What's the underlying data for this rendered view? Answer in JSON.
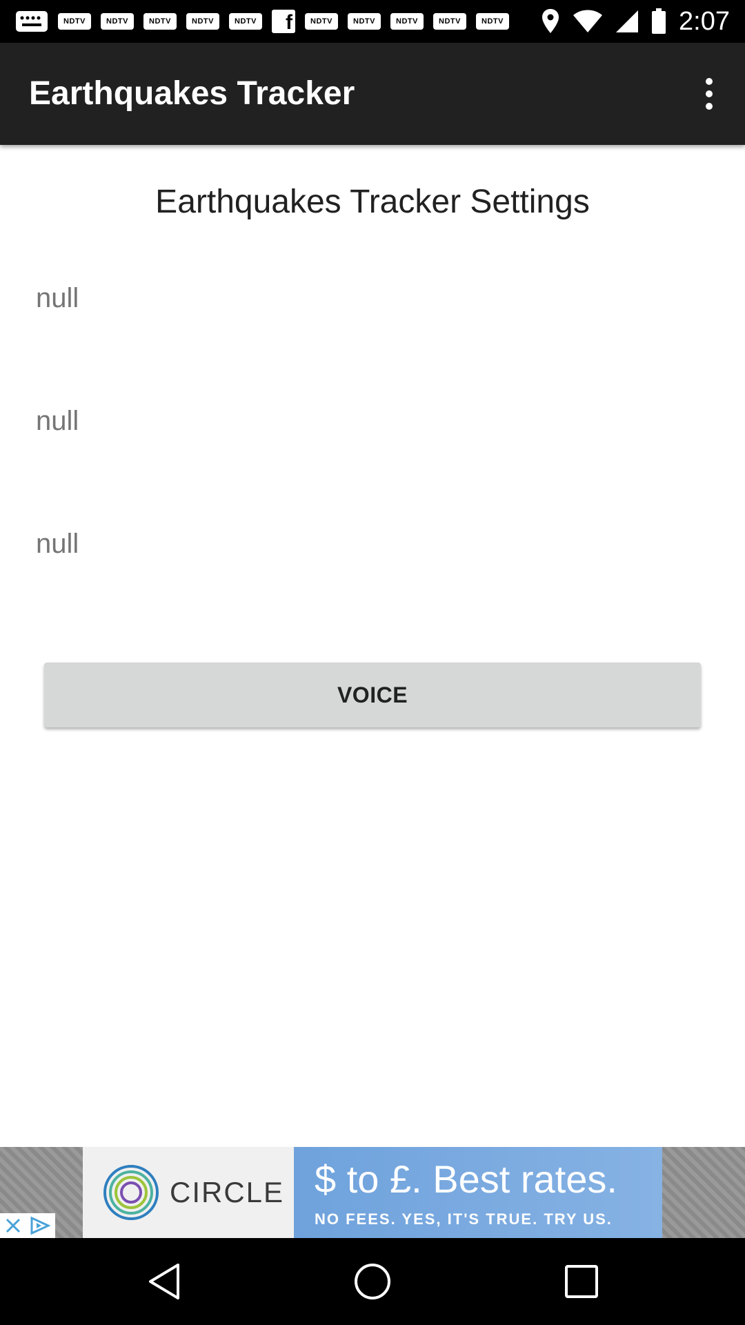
{
  "status_bar": {
    "time": "2:07",
    "notification_labels": [
      "NDTV",
      "NDTV",
      "NDTV",
      "NDTV",
      "NDTV",
      "NDTV",
      "NDTV",
      "NDTV",
      "NDTV",
      "NDTV"
    ],
    "icons": [
      "message-icon",
      "facebook-icon",
      "location-icon",
      "wifi-icon",
      "signal-icon",
      "battery-icon"
    ]
  },
  "app_bar": {
    "title": "Earthquakes Tracker",
    "menu_icon": "overflow-menu-icon"
  },
  "settings": {
    "heading": "Earthquakes Tracker Settings",
    "items": [
      "null",
      "null",
      "null"
    ],
    "voice_button": "VOICE"
  },
  "ad": {
    "brand": "CIRCLE",
    "headline": "$ to £. Best rates.",
    "subline": "NO FEES. YES, IT'S TRUE. TRY US.",
    "icons": [
      "close-icon",
      "adchoices-icon"
    ]
  },
  "nav_bar": {
    "icons": [
      "back-icon",
      "home-icon",
      "recents-icon"
    ]
  },
  "colors": {
    "app_bar": "#212121",
    "button_bg": "#d6d7d7",
    "null_text": "#757575",
    "ad_blue": "#6fa2dc"
  }
}
